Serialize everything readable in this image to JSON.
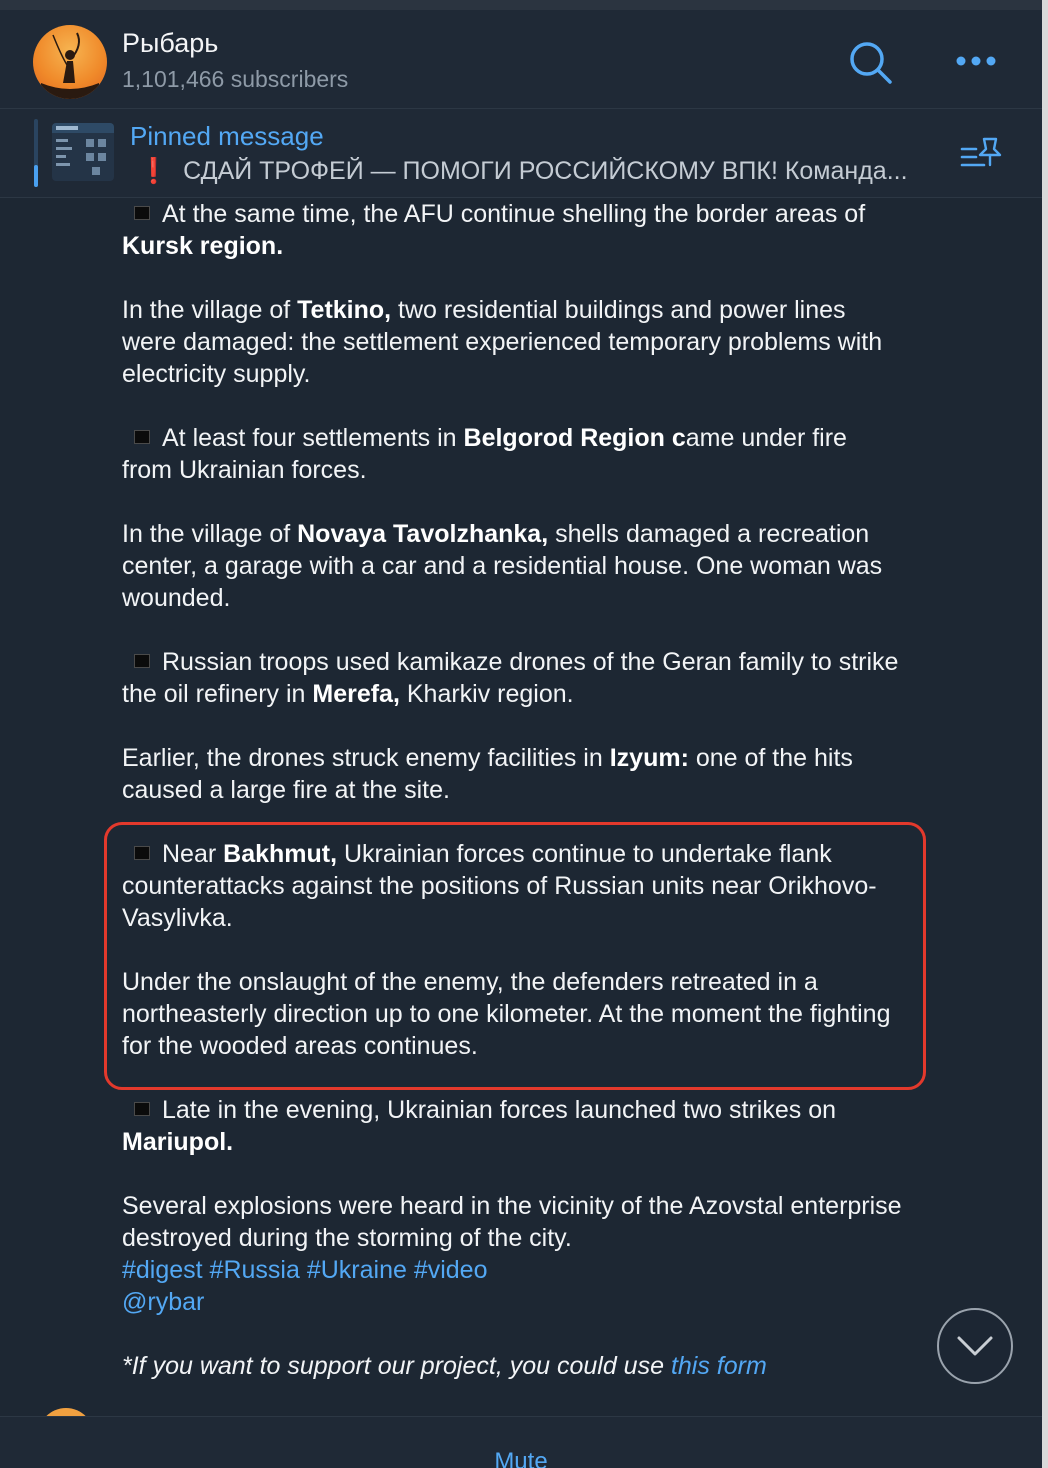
{
  "header": {
    "title": "Рыбарь",
    "subscribers": "1,101,466 subscribers"
  },
  "pinned": {
    "label": "Pinned message",
    "icon_mark": "❗",
    "preview": "СДАЙ ТРОФЕЙ — ПОМОГИ РОССИЙСКОМУ ВПК!  Команда..."
  },
  "message": {
    "p1a": "At the same time, the AFU continue shelling the border areas of ",
    "p1b": "Kursk region.",
    "p2a": "In the village of ",
    "p2b": "Tetkino,",
    "p2c": " two residential buildings and power lines were damaged: the settlement experienced temporary problems with electricity supply.",
    "p3a": "At least four settlements in ",
    "p3b": "Belgorod Region c",
    "p3c": "ame under fire from Ukrainian forces.",
    "p4a": "In the village of ",
    "p4b": "Novaya Tavolzhanka,",
    "p4c": " shells damaged a recreation center, a garage with a car and a residential house. One woman was wounded.",
    "p5a": "Russian troops used kamikaze drones of the Geran family to strike the oil refinery in ",
    "p5b": "Merefa,",
    "p5c": " Kharkiv region.",
    "p6a": "Earlier, the drones struck enemy facilities in ",
    "p6b": "Izyum:",
    "p6c": " one of the hits caused a large fire at the site.",
    "p7a": "Near ",
    "p7b": "Bakhmut,",
    "p7c": " Ukrainian forces continue to undertake flank counterattacks against the positions of Russian units near Orikhovo-Vasylivka.",
    "p8": "Under the onslaught of the enemy, the defenders retreated in a northeasterly direction up to one kilometer. At the moment the fighting for the wooded areas continues.",
    "p9a": "Late in the evening, Ukrainian forces launched two strikes on ",
    "p9b": "Mariupol.",
    "p10": "Several explosions were heard in the vicinity of the Azovstal enterprise destroyed during the storming of the city.",
    "hashtags": "#digest #Russia #Ukraine #video",
    "mention": "@rybar",
    "support_text": "*If you want to support our project, you could use ",
    "support_link": "this form"
  },
  "bottom": {
    "mute_label": "Mute"
  },
  "icons": [
    "search-icon",
    "more-icon",
    "pinned-list-icon",
    "chevron-down-icon",
    "bullet-square-icon"
  ],
  "colors": {
    "background": "#1d2733",
    "accent": "#53a8f4",
    "highlight_border": "#e3392c"
  }
}
